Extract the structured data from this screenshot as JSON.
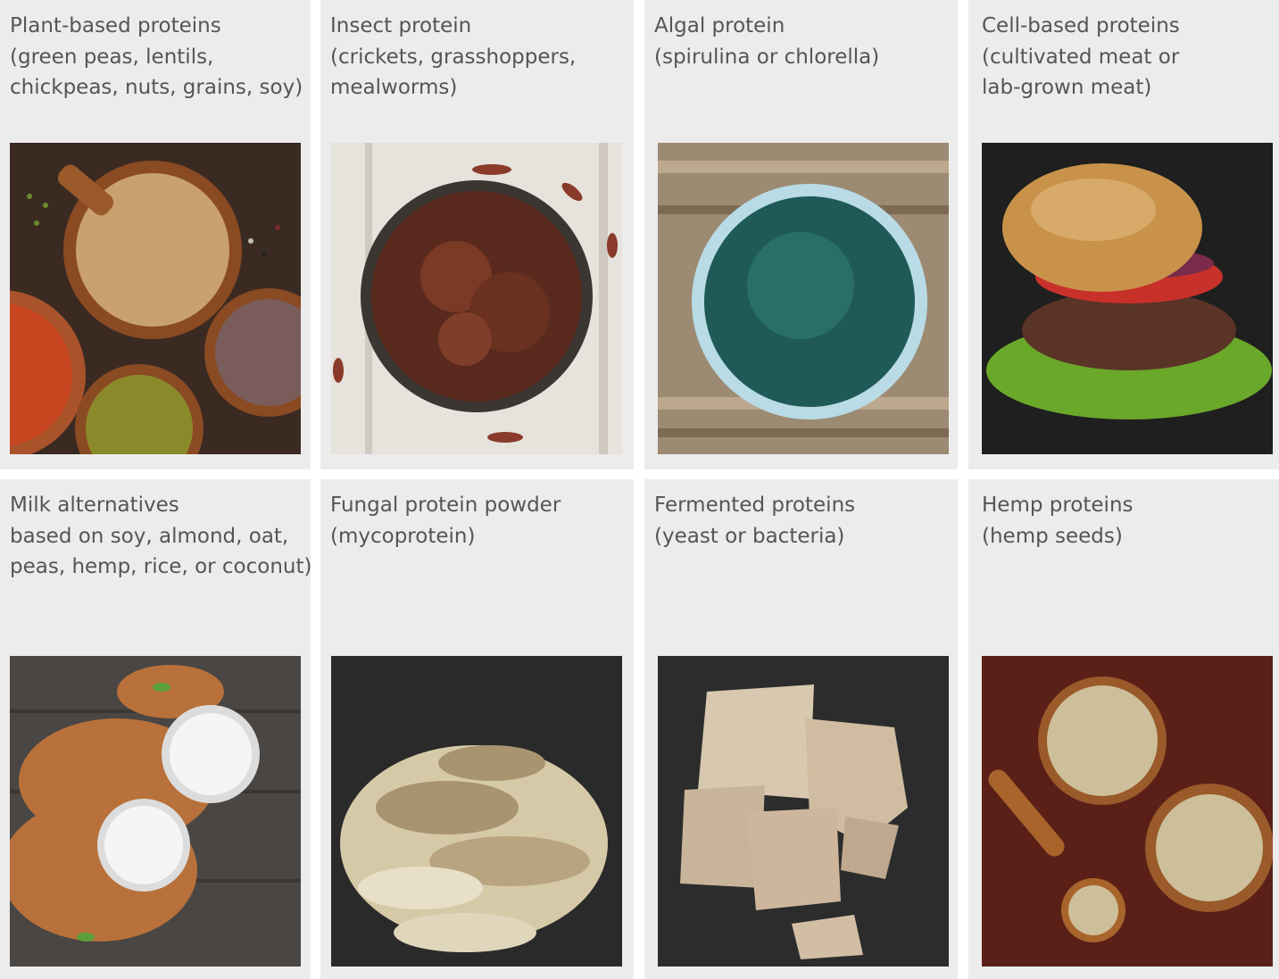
{
  "cards": [
    {
      "lines": [
        "Plant-based proteins",
        "(green peas, lentils,",
        "chickpeas, nuts, grains, soy)"
      ],
      "image": "legumes-grains-nuts-bowls-photo"
    },
    {
      "lines": [
        "Insect protein",
        "(crickets, grasshoppers,",
        "mealworms)"
      ],
      "image": "roasted-crickets-bowl-photo"
    },
    {
      "lines": [
        "Algal protein",
        "(spirulina or chlorella)"
      ],
      "image": "spirulina-powder-bowl-photo"
    },
    {
      "lines": [
        "Cell-based proteins",
        "(cultivated meat or",
        "lab-grown meat)"
      ],
      "image": "burger-photo"
    },
    {
      "lines": [
        "Milk alternatives",
        "based on soy, almond, oat,",
        "peas, hemp, rice, or coconut)"
      ],
      "image": "almond-milk-glasses-photo"
    },
    {
      "lines": [
        "Fungal protein powder",
        "(mycoprotein)"
      ],
      "image": "oyster-mushrooms-photo"
    },
    {
      "lines": [
        "Fermented proteins",
        "(yeast or bacteria)"
      ],
      "image": "fresh-yeast-blocks-photo"
    },
    {
      "lines": [
        "Hemp proteins",
        "(hemp seeds)"
      ],
      "image": "hemp-seeds-bowls-photo"
    }
  ],
  "colors": {
    "card_background": "#ececec",
    "caption_text": "#555555"
  }
}
